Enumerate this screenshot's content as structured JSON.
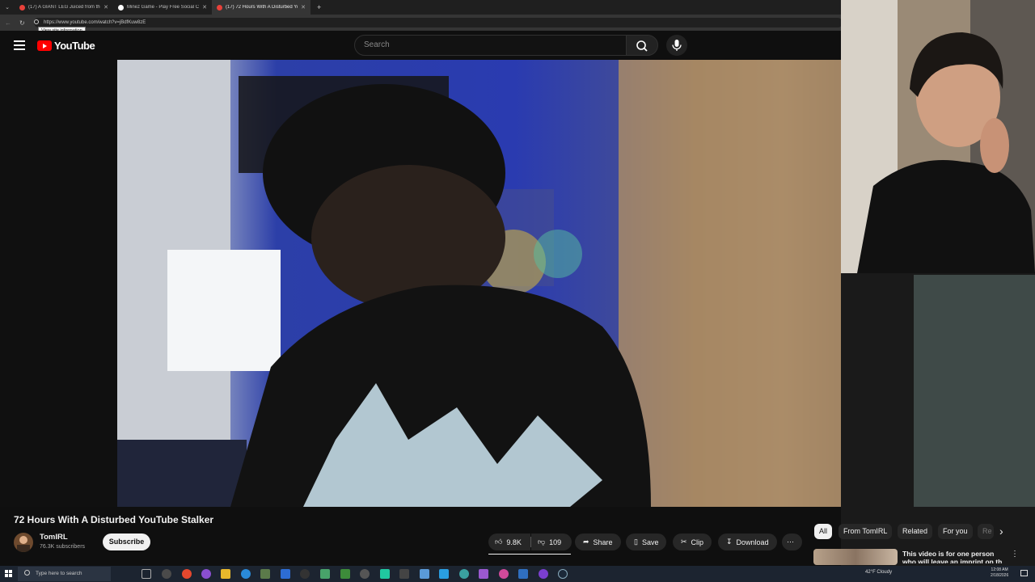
{
  "browser": {
    "tabs": [
      {
        "title": "(17) A GIANT LEG Juiced from the",
        "active": false,
        "color": "#e8413a"
      },
      {
        "title": "Minez Game - Play Free Social Cr",
        "active": false,
        "color": "#ffffff"
      },
      {
        "title": "(17) 72 Hours With A Disturbed Yo",
        "active": true,
        "color": "#e8413a"
      }
    ],
    "new_tab_label": "+",
    "url": "https://www.youtube.com/watch?v=jBdfKuw8zE",
    "tooltip": "View site information"
  },
  "youtube": {
    "logo_text": "YouTube",
    "search_placeholder": "Search",
    "video_title": "72 Hours With A Disturbed YouTube Stalker",
    "channel_name": "TomIRL",
    "subscribers": "76.3K subscribers",
    "subscribe_label": "Subscribe",
    "actions": {
      "likes": "9.8K",
      "dislikes": "109",
      "share": "Share",
      "save": "Save",
      "clip": "Clip",
      "download": "Download"
    },
    "chips": [
      "All",
      "From TomIRL",
      "Related",
      "For you",
      "Re"
    ],
    "recommendation_title": "This video is for one person who will leave an imprint on th"
  },
  "taskbar": {
    "search_placeholder": "Type here to search",
    "weather": "42°F Cloudy",
    "time": "12:08 AM",
    "date": "2/18/2026"
  }
}
